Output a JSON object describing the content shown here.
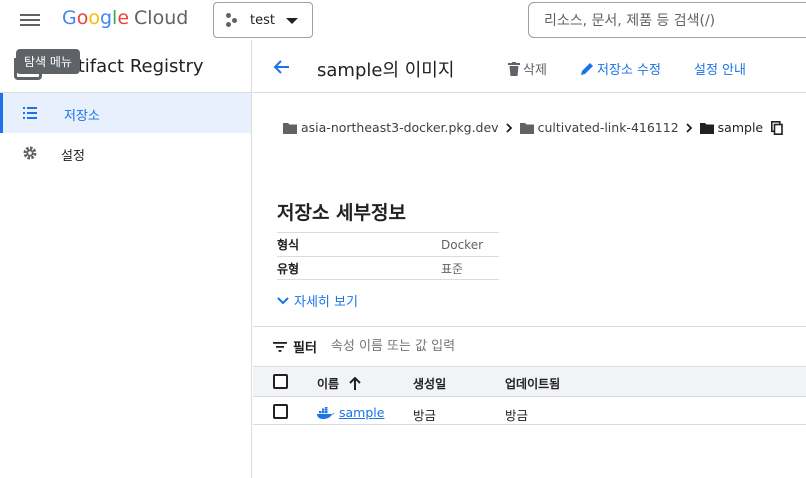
{
  "topbar": {
    "logo_g": "G",
    "logo_o1": "o",
    "logo_o2": "o",
    "logo_g2": "g",
    "logo_l": "l",
    "logo_e": "e",
    "logo_cloud": "Cloud",
    "project_name": "test",
    "search_placeholder": "리소스, 문서, 제품 등 검색(/)"
  },
  "sidebar": {
    "title": "Artifact Registry",
    "tooltip": "탐색 메뉴",
    "items": [
      {
        "label": "저장소",
        "icon": "list-icon",
        "active": true
      },
      {
        "label": "설정",
        "icon": "gear-icon",
        "active": false
      }
    ]
  },
  "header": {
    "title": "sample의 이미지",
    "delete_label": "삭제",
    "edit_label": "저장소 수정",
    "setup_label": "설정 안내"
  },
  "breadcrumb": [
    {
      "label": "asia-northeast3-docker.pkg.dev"
    },
    {
      "label": "cultivated-link-416112"
    },
    {
      "label": "sample"
    }
  ],
  "details": {
    "title": "저장소 세부정보",
    "rows": [
      {
        "key": "형식",
        "value": "Docker"
      },
      {
        "key": "유형",
        "value": "표준"
      }
    ],
    "more_label": "자세히 보기"
  },
  "filter": {
    "label": "필터",
    "placeholder": "속성 이름 또는 값 입력"
  },
  "table": {
    "columns": [
      "이름",
      "생성일",
      "업데이트됨"
    ],
    "rows": [
      {
        "name": "sample",
        "created": "방금",
        "updated": "방금"
      }
    ]
  },
  "colors": {
    "accent": "#1a73e8",
    "active_bg": "#e8f0fe"
  }
}
